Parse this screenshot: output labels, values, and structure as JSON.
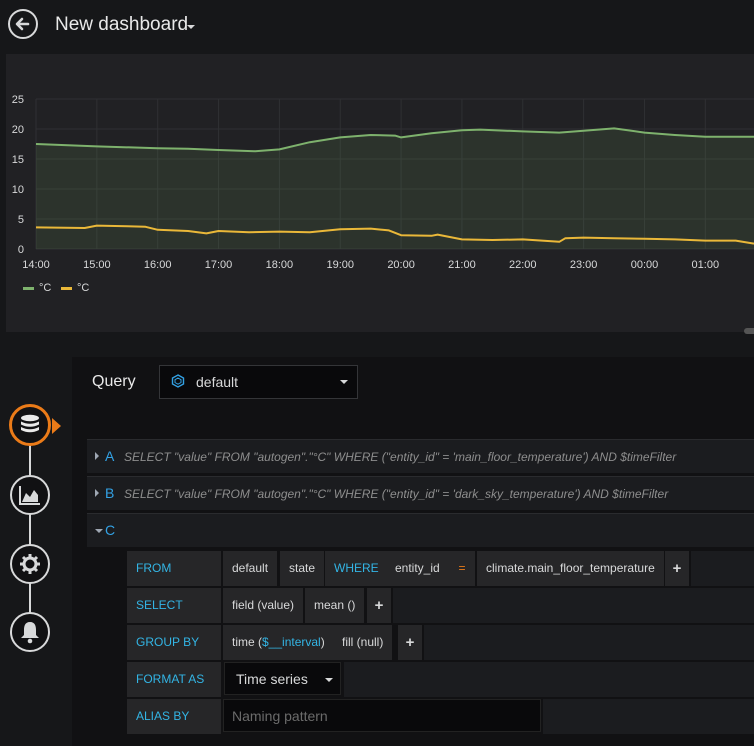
{
  "header": {
    "title": "New dashboard"
  },
  "panel": {
    "legend": [
      {
        "label": "°C",
        "color": "#7eb26d"
      },
      {
        "label": "°C",
        "color": "#eab839"
      }
    ]
  },
  "chart_data": {
    "type": "line",
    "x_ticks": [
      "14:00",
      "15:00",
      "16:00",
      "17:00",
      "18:00",
      "19:00",
      "20:00",
      "21:00",
      "22:00",
      "23:00",
      "00:00",
      "01:00"
    ],
    "y_ticks": [
      "0",
      "5",
      "10",
      "15",
      "20",
      "25"
    ],
    "ylim": [
      0,
      25
    ],
    "xlim_hours": [
      14,
      25.8
    ],
    "grid": true,
    "series": [
      {
        "name": "°C",
        "color": "#7eb26d",
        "fill": true,
        "x": [
          14.0,
          15.0,
          16.0,
          16.5,
          17.0,
          17.6,
          18.0,
          18.5,
          19.0,
          19.5,
          19.9,
          20.0,
          20.5,
          21.0,
          21.3,
          22.0,
          22.6,
          23.0,
          23.5,
          24.0,
          24.5,
          25.0,
          25.3,
          25.8
        ],
        "values": [
          17.5,
          17.1,
          16.8,
          16.7,
          16.5,
          16.3,
          16.6,
          17.8,
          18.6,
          19.0,
          18.9,
          18.6,
          19.3,
          19.8,
          19.9,
          19.6,
          19.4,
          19.7,
          20.1,
          19.4,
          19.0,
          18.7,
          18.7,
          18.7
        ]
      },
      {
        "name": "°C",
        "color": "#eab839",
        "fill": false,
        "x": [
          14.0,
          14.8,
          15.0,
          15.5,
          15.8,
          16.0,
          16.5,
          16.8,
          17.0,
          17.5,
          18.0,
          18.5,
          19.0,
          19.5,
          19.8,
          20.0,
          20.5,
          20.6,
          21.0,
          21.5,
          22.0,
          22.6,
          22.7,
          23.0,
          23.5,
          24.0,
          24.5,
          25.0,
          25.5,
          25.8
        ],
        "values": [
          3.6,
          3.5,
          3.9,
          3.8,
          3.7,
          3.2,
          3.0,
          2.6,
          3.0,
          2.8,
          2.9,
          2.8,
          3.3,
          3.4,
          3.1,
          2.3,
          2.2,
          2.4,
          1.6,
          1.5,
          1.6,
          1.2,
          1.8,
          1.9,
          1.8,
          1.7,
          1.6,
          1.4,
          1.4,
          0.9
        ]
      }
    ]
  },
  "editor": {
    "query_label": "Query",
    "datasource": "default",
    "queries": [
      {
        "letter": "A",
        "text": "SELECT \"value\" FROM \"autogen\".\"°C\" WHERE (\"entity_id\" = 'main_floor_temperature') AND $timeFilter"
      },
      {
        "letter": "B",
        "text": "SELECT \"value\" FROM \"autogen\".\"°C\" WHERE (\"entity_id\" = 'dark_sky_temperature') AND $timeFilter"
      },
      {
        "letter": "C",
        "text": ""
      }
    ],
    "builder": {
      "from_label": "FROM",
      "from_policy": "default",
      "from_measurement": "state",
      "where_label": "WHERE",
      "where_key": "entity_id",
      "where_op": "=",
      "where_value": "climate.main_floor_temperature",
      "select_label": "SELECT",
      "select_field": "field (value)",
      "select_fn": "mean ()",
      "groupby_label": "GROUP BY",
      "groupby_time_prefix": "time (",
      "groupby_time_var": "$__interval",
      "groupby_time_suffix": ")",
      "groupby_fill": "fill (null)",
      "format_label": "FORMAT AS",
      "format_value": "Time series",
      "alias_label": "ALIAS BY",
      "alias_placeholder": "Naming pattern",
      "plus": "+"
    }
  }
}
